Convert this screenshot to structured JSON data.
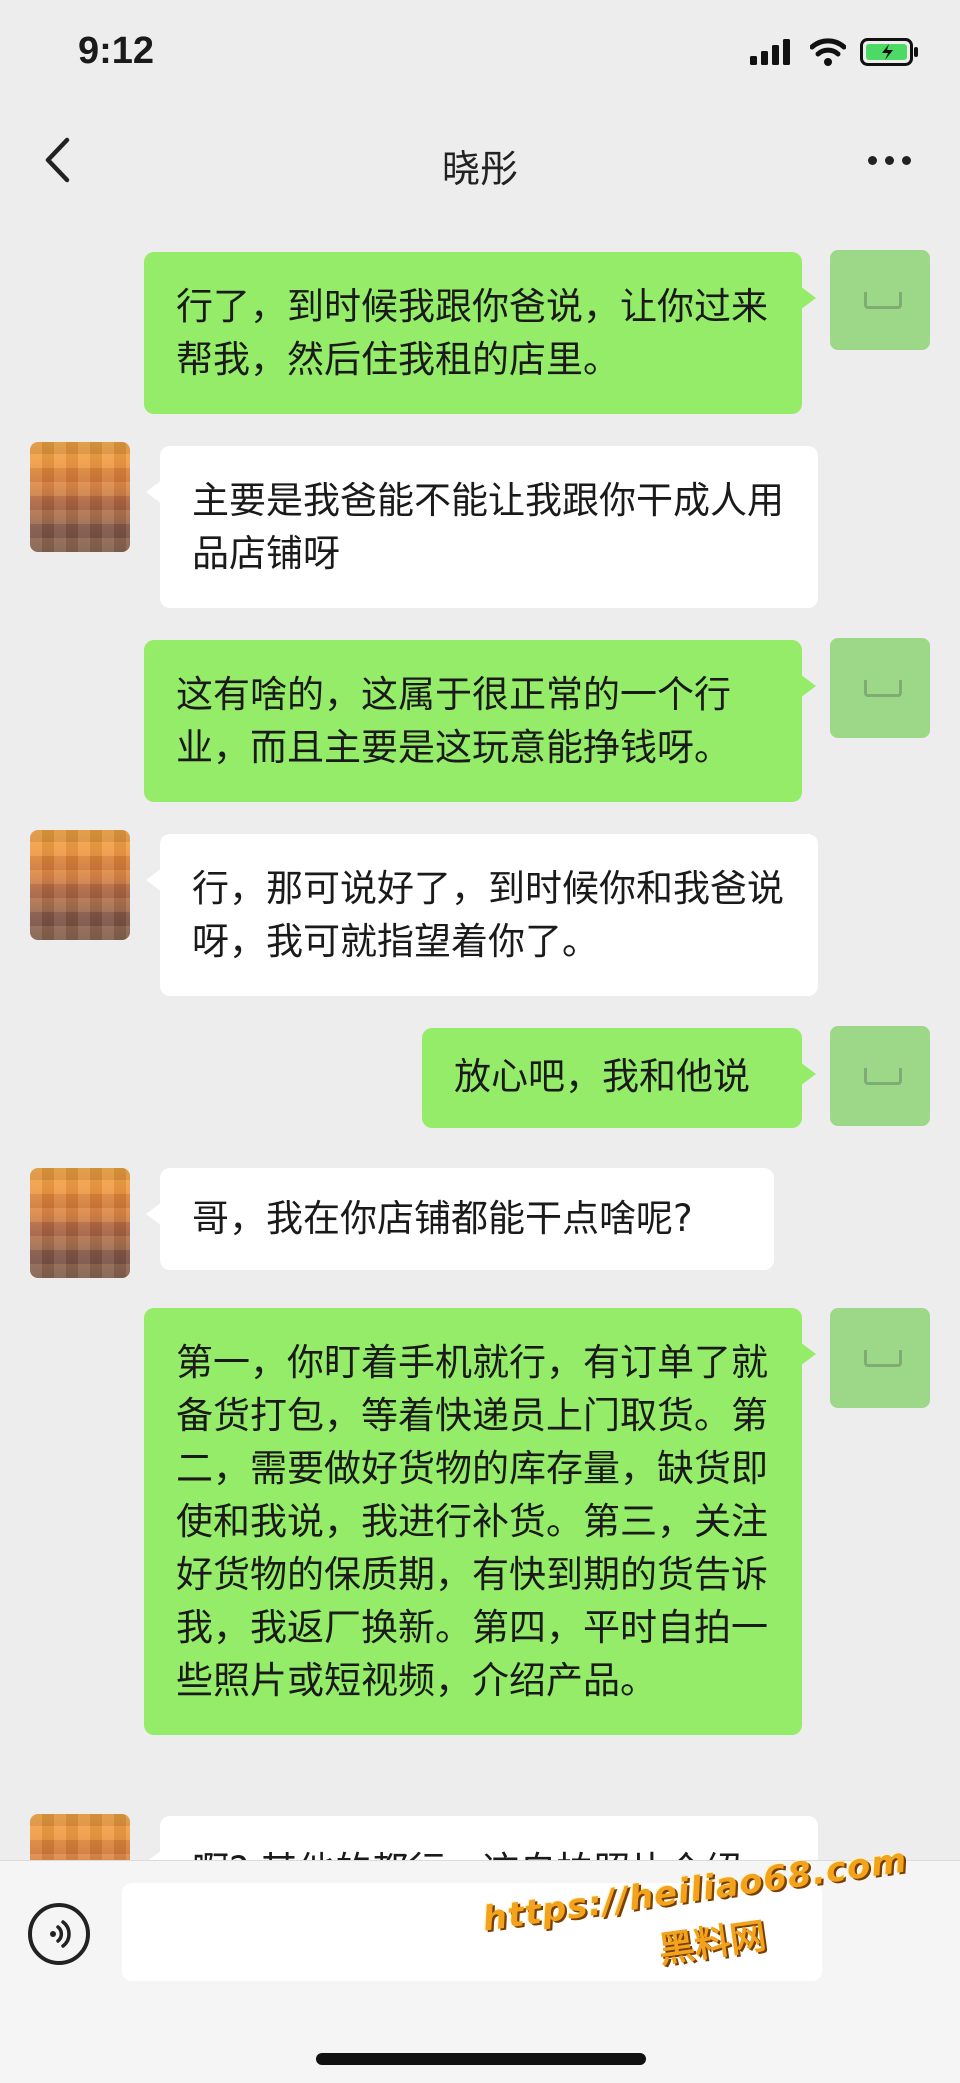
{
  "status_bar": {
    "time": "9:12"
  },
  "nav": {
    "title": "晓彤"
  },
  "messages": [
    {
      "sender": "self",
      "text": "行了，到时候我跟你爸说，让你过来帮我，然后住我租的店里。"
    },
    {
      "sender": "other",
      "text": "主要是我爸能不能让我跟你干成人用品店铺呀"
    },
    {
      "sender": "self",
      "text": "这有啥的，这属于很正常的一个行业，而且主要是这玩意能挣钱呀。"
    },
    {
      "sender": "other",
      "text": "行，那可说好了，到时候你和我爸说呀，我可就指望着你了。"
    },
    {
      "sender": "self",
      "text": "放心吧，我和他说"
    },
    {
      "sender": "other",
      "text": "哥，我在你店铺都能干点啥呢?"
    },
    {
      "sender": "self",
      "text": "第一，你盯着手机就行，有订单了就备货打包，等着快递员上门取货。第二，需要做好货物的库存量，缺货即使和我说，我进行补货。第三，关注好货物的保质期，有快到期的货告诉我，我返厂换新。第四，平时自拍一些照片或短视频，介绍产品。"
    },
    {
      "sender": "other",
      "text": "啊? 其他的都行，这自拍照片介绍"
    }
  ],
  "input_bar": {
    "placeholder": ""
  },
  "watermark": {
    "url": "https://heiliao68.com",
    "name": "黑料网"
  },
  "colors": {
    "self_bubble": "#95ec69",
    "other_bubble": "#ffffff",
    "background": "#ededed"
  },
  "icons": [
    "back-chevron-icon",
    "more-dots-icon",
    "signal-icon",
    "wifi-icon",
    "battery-icon",
    "voice-icon"
  ]
}
